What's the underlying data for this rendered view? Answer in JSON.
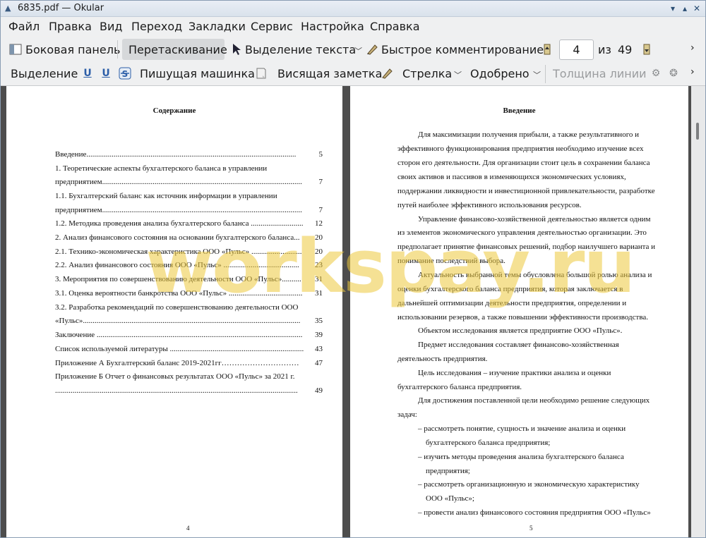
{
  "window": {
    "title": "6835.pdf  — Okular"
  },
  "menu": [
    "Файл",
    "Правка",
    "Вид",
    "Переход",
    "Закладки",
    "Сервис",
    "Настройка",
    "Справка"
  ],
  "toolbar1": {
    "sidebar": "Боковая панель",
    "drag": "Перетаскивание",
    "text_select": "Выделение текста",
    "quick_comment": "Быстрое комментирование",
    "page_current": "4",
    "page_of": "из",
    "page_total": "49"
  },
  "toolbar2": {
    "selection": "Выделение",
    "typewriter": "Пишущая машинка",
    "hanging_note": "Висящая заметка",
    "arrow": "Стрелка",
    "approved": "Одобрено",
    "line_width": "Толщина линии"
  },
  "left_page": {
    "title": "Содержание",
    "page_number": "4",
    "toc": [
      {
        "t": "Введение............................................................................................................",
        "p": "5"
      },
      {
        "t": "1.   Теоретические   аспекты   бухгалтерского   баланса   в   управлении",
        "p": ""
      },
      {
        "t": "предприятием.......................................................................................................",
        "p": "7"
      },
      {
        "t": "1.1.   Бухгалтерский   баланс   как   источник   информации   в   управлении",
        "p": ""
      },
      {
        "t": "предприятием.......................................................................................................",
        "p": "7"
      },
      {
        "t": "1.2. Методика проведения анализа бухгалтерского баланса ...........................",
        "p": "12"
      },
      {
        "t": "2.    Анализ финансового состояния на основании бухгалтерского баланса...",
        "p": "20"
      },
      {
        "t": "2.1.    Технико-экономическая характеристика ООО «Пульс» ..........................",
        "p": "20"
      },
      {
        "t": "2.2.    Анализ финансового состояния ООО «Пульс» .......................................",
        "p": "23"
      },
      {
        "t": "3.    Мероприятия по совершенствованию деятельности ООО «Пульс»..........",
        "p": "31"
      },
      {
        "t": "3.1.    Оценка вероятности банкротства ООО «Пульс» ......................................",
        "p": "31"
      },
      {
        "t": "3.2.  Разработка  рекомендаций  по  совершенствованию  деятельности  ООО",
        "p": ""
      },
      {
        "t": "«Пульс»................................................................................................................",
        "p": "35"
      },
      {
        "t": "Заключение ..........................................................................................................",
        "p": "39"
      },
      {
        "t": "Список используемой литературы .....................................................................",
        "p": "43"
      },
      {
        "t": "Приложение А Бухгалтерский баланс 2019-2021гг…………………………",
        "p": "47"
      },
      {
        "t": "Приложение Б Отчет  о  финансовых  результатах  ООО  «Пульс»  за  2021  г.",
        "p": ""
      },
      {
        "t": ".............................................................................................................................",
        "p": "49"
      }
    ]
  },
  "right_page": {
    "title": "Введение",
    "page_number": "5",
    "lines": [
      "Для максимизации получения прибыли, а также результативного и",
      "эффективного функционирования предприятия необходимо изучение всех",
      "сторон его деятельности. Для организации стоит цель в сохранении баланса",
      "своих активов и пассивов в изменяющихся экономических условиях,",
      "поддержании ликвидности и инвестиционной привлекательности, разработке",
      "путей наиболее эффективного использования ресурсов.",
      "Управление финансово-хозяйственной деятельностью является одним",
      "из элементов экономического управления деятельностью организации. Это",
      "предполагает принятие финансовых решений, подбор наилучшего варианта и",
      "понимание последствий выбора.",
      "Актуальность выбранной темы обусловлена большой ролью анализа и",
      "оценки бухгалтерского баланса предприятия, которая заключается в",
      "дальнейшей оптимизации деятельности предприятия, определении и",
      "использовании резервов, а также повышении эффективности производства.",
      "Объектом исследования является предприятие ООО «Пульс».",
      "Предмет исследования составляет финансово-хозяйственная",
      "деятельность предприятия.",
      "Цель исследования – изучение практики анализа и оценки",
      "бухгалтерского баланса предприятия.",
      "Для достижения поставленной цели необходимо решение следующих",
      "задач:",
      "–  рассмотреть понятие, сущность и значение анализа и оценки",
      "бухгалтерского баланса предприятия;",
      "–  изучить методы проведения анализа бухгалтерского баланса",
      "предприятия;",
      "–  рассмотреть организационную и экономическую характеристику",
      "ООО «Пульс»;",
      "–  провести анализ финансового состояния предприятия ООО «Пульс»"
    ]
  },
  "watermark": "workspay.ru"
}
